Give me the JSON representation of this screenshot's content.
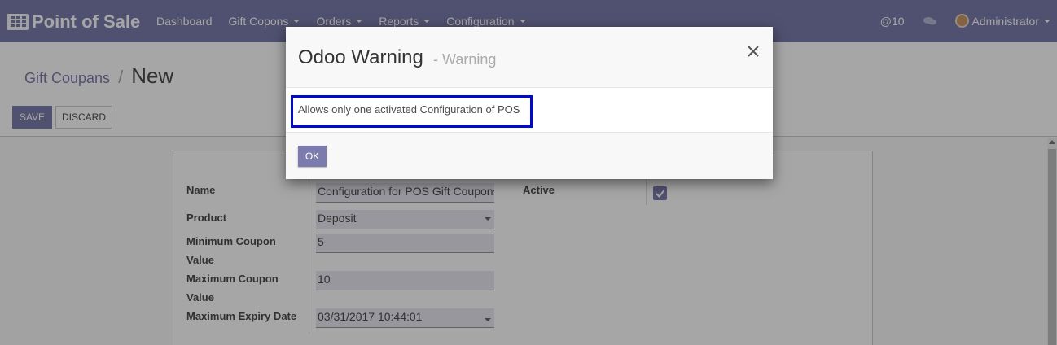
{
  "navbar": {
    "app_title": "Point of Sale",
    "menu": [
      {
        "label": "Dashboard",
        "dropdown": false
      },
      {
        "label": "Gift Copons",
        "dropdown": true
      },
      {
        "label": "Orders",
        "dropdown": true
      },
      {
        "label": "Reports",
        "dropdown": true
      },
      {
        "label": "Configuration",
        "dropdown": true
      }
    ],
    "activity_count": "@10",
    "user_name": "Administrator",
    "accent_color": "#7c7bad"
  },
  "breadcrumb": {
    "parent": "Gift Coupans",
    "separator": "/",
    "current": "New"
  },
  "buttons": {
    "save": "SAVE",
    "discard": "DISCARD"
  },
  "form": {
    "name_label": "Name",
    "name_value": "Configuration for POS Gift Coupons",
    "product_label": "Product",
    "product_value": "Deposit",
    "min_coupon_label_1": "Minimum Coupon",
    "min_coupon_label_2": "Value",
    "min_coupon_value": "5",
    "max_coupon_label_1": "Maximum Coupon",
    "max_coupon_label_2": "Value",
    "max_coupon_value": "10",
    "expiry_label": "Maximum Expiry Date",
    "expiry_value": "03/31/2017 10:44:01",
    "active_label": "Active",
    "active_checked": true
  },
  "dialog": {
    "title": "Odoo Warning",
    "subtitle": "- Warning",
    "message": "Allows only one activated Configuration of POS",
    "ok_label": "OK",
    "highlight_color": "#0009ce"
  }
}
